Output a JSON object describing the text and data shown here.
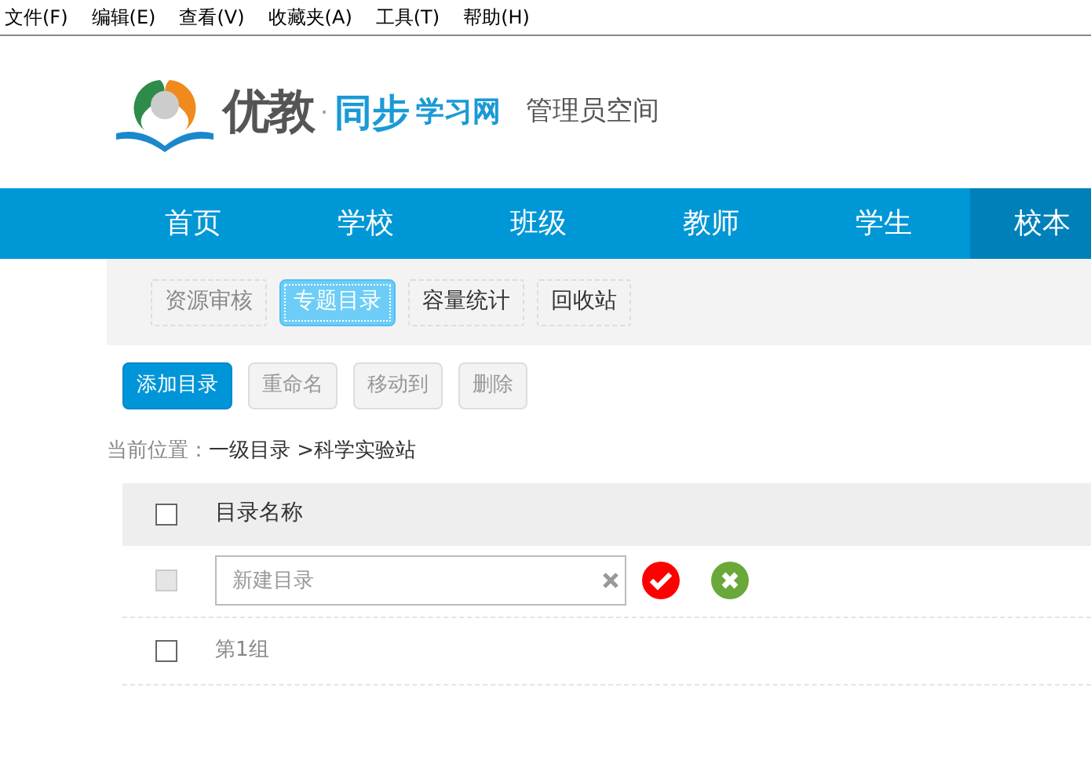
{
  "menu": [
    "文件(F)",
    "编辑(E)",
    "查看(V)",
    "收藏夹(A)",
    "工具(T)",
    "帮助(H)"
  ],
  "logo": {
    "brand": "优教",
    "dot": "·",
    "sub_main": "同步",
    "sub_rest": "学习网",
    "title": "管理员空间"
  },
  "nav": [
    {
      "label": "首页",
      "selected": false
    },
    {
      "label": "学校",
      "selected": false
    },
    {
      "label": "班级",
      "selected": false
    },
    {
      "label": "教师",
      "selected": false
    },
    {
      "label": "学生",
      "selected": false
    },
    {
      "label": "校本",
      "selected": true
    }
  ],
  "subtabs": [
    {
      "label": "资源审核",
      "selected": false,
      "disabled": true
    },
    {
      "label": "专题目录",
      "selected": true,
      "disabled": false
    },
    {
      "label": "容量统计",
      "selected": false,
      "disabled": false
    },
    {
      "label": "回收站",
      "selected": false,
      "disabled": false
    }
  ],
  "toolbar": [
    {
      "label": "添加目录",
      "disabled": false
    },
    {
      "label": "重命名",
      "disabled": true
    },
    {
      "label": "移动到",
      "disabled": true
    },
    {
      "label": "删除",
      "disabled": true
    }
  ],
  "breadcrumb": {
    "label": "当前位置：",
    "path": "一级目录 >科学实验站"
  },
  "table": {
    "header": {
      "label": "目录名称",
      "checked": false
    },
    "rows": [
      {
        "kind": "edit",
        "checked": false,
        "disabled": true,
        "placeholder": "新建目录"
      },
      {
        "kind": "item",
        "checked": false,
        "disabled": false,
        "name": "第1组"
      }
    ]
  }
}
